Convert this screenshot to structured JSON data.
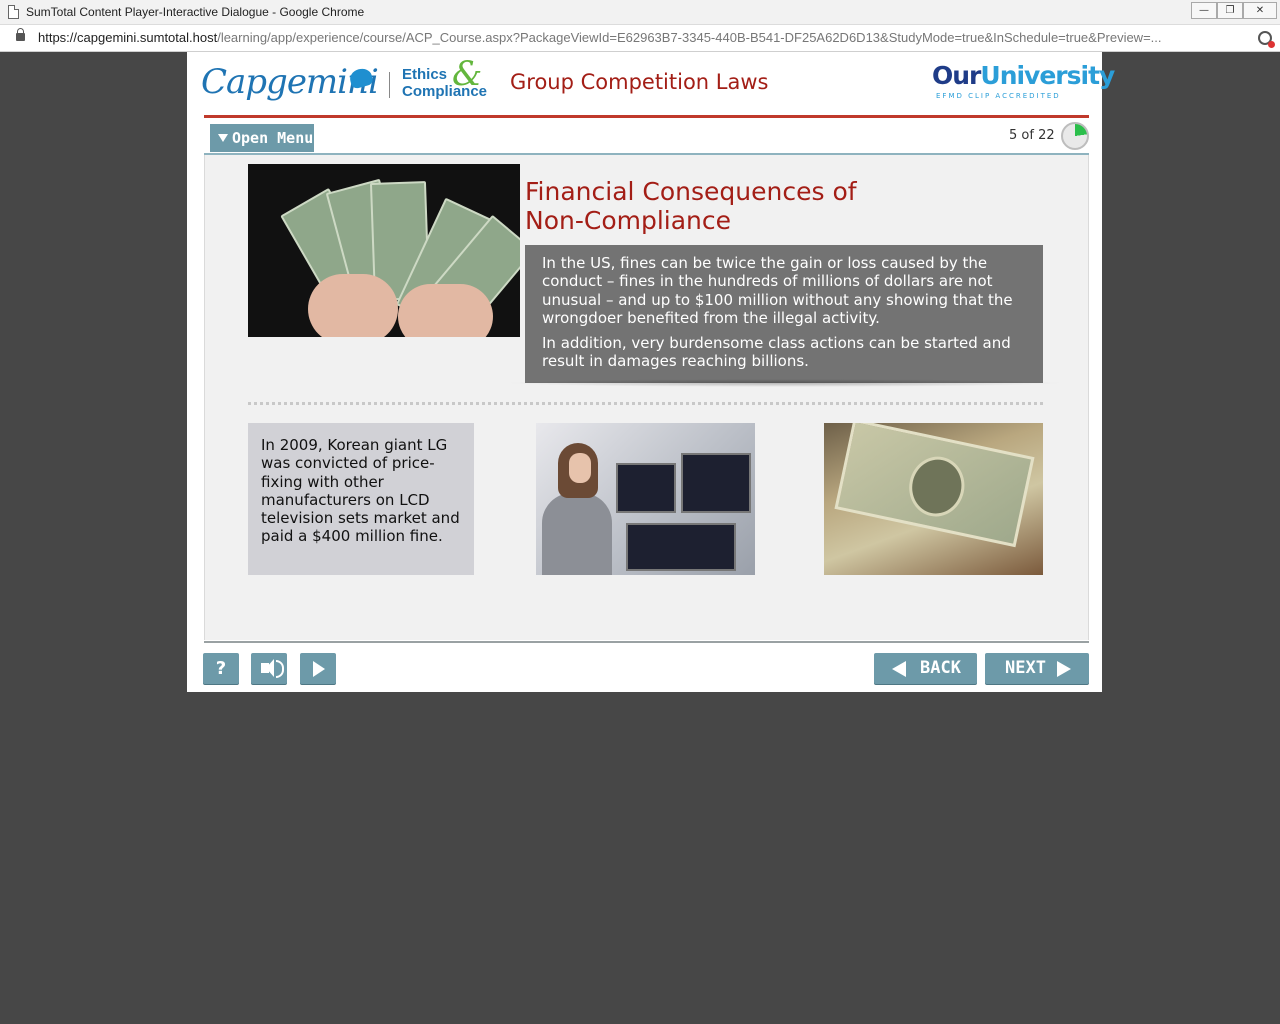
{
  "window": {
    "title": "SumTotal Content Player-Interactive Dialogue - Google Chrome",
    "url_host": "https://capgemini.sumtotal.host",
    "url_path": "/learning/app/experience/course/ACP_Course.aspx?PackageViewId=E62963B7-3345-440B-B541-DF25A62D6D13&StudyMode=true&InSchedule=true&Preview=..."
  },
  "header": {
    "brand": "Capgemini",
    "ethics_line1": "Ethics",
    "ethics_amp": "&",
    "ethics_line2": "Compliance",
    "course_title": "Group Competition Laws",
    "partner_logo_main": "Our",
    "partner_logo_uni": "University",
    "partner_logo_sub": "EFMD CLIP ACCREDITED"
  },
  "nav": {
    "open_menu_label": "Open Menu",
    "page_counter": "5 of 22",
    "progress_fraction": 0.227
  },
  "slide": {
    "heading": "Financial Consequences of Non-Compliance",
    "paragraph_1": "In the US, fines can be twice the gain or loss caused by the conduct – fines in the hundreds of millions of dollars are not unusual – and up to $100 million without any showing that the wrongdoer benefited from the illegal activity.",
    "paragraph_2": "In addition, very burdensome class actions can be started and result in damages reaching billions.",
    "case_text": "In 2009, Korean giant LG was convicted of price-fixing with other manufacturers on LCD television sets market and paid a $400 million fine."
  },
  "controls": {
    "help_label": "?",
    "back_label": "BACK",
    "next_label": "NEXT"
  },
  "colors": {
    "accent_red": "#a31e16",
    "button_teal": "#6d9aa9",
    "brand_blue": "#1f74b3"
  }
}
